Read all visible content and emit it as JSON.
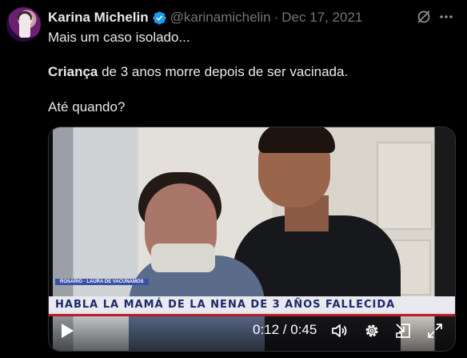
{
  "author": {
    "name": "Karina Michelin",
    "handle": "@karinamichelin",
    "separator": "·",
    "date": "Dec 17, 2021",
    "verified": true
  },
  "tweet": {
    "line1": "Mais um caso isolado...",
    "line2_bold": "Criança",
    "line2_rest": " de 3 anos morre depois de ser vacinada.",
    "line3": "Até quando?"
  },
  "video": {
    "banner_small": "ROSARIO · LAURA DE VACUNAMOS",
    "banner": "HABLA LA MAMÁ DE LA NENA DE 3 AÑOS FALLECIDA",
    "banner_color": "#1b2a6b",
    "time": "0:12 / 0:45",
    "controls": [
      "play-icon",
      "volume-icon",
      "settings-icon",
      "pip-icon",
      "fullscreen-icon"
    ]
  },
  "colors": {
    "background": "#000000",
    "text": "#e7e9ea",
    "muted": "#71767b",
    "verified": "#1d9bf0"
  }
}
